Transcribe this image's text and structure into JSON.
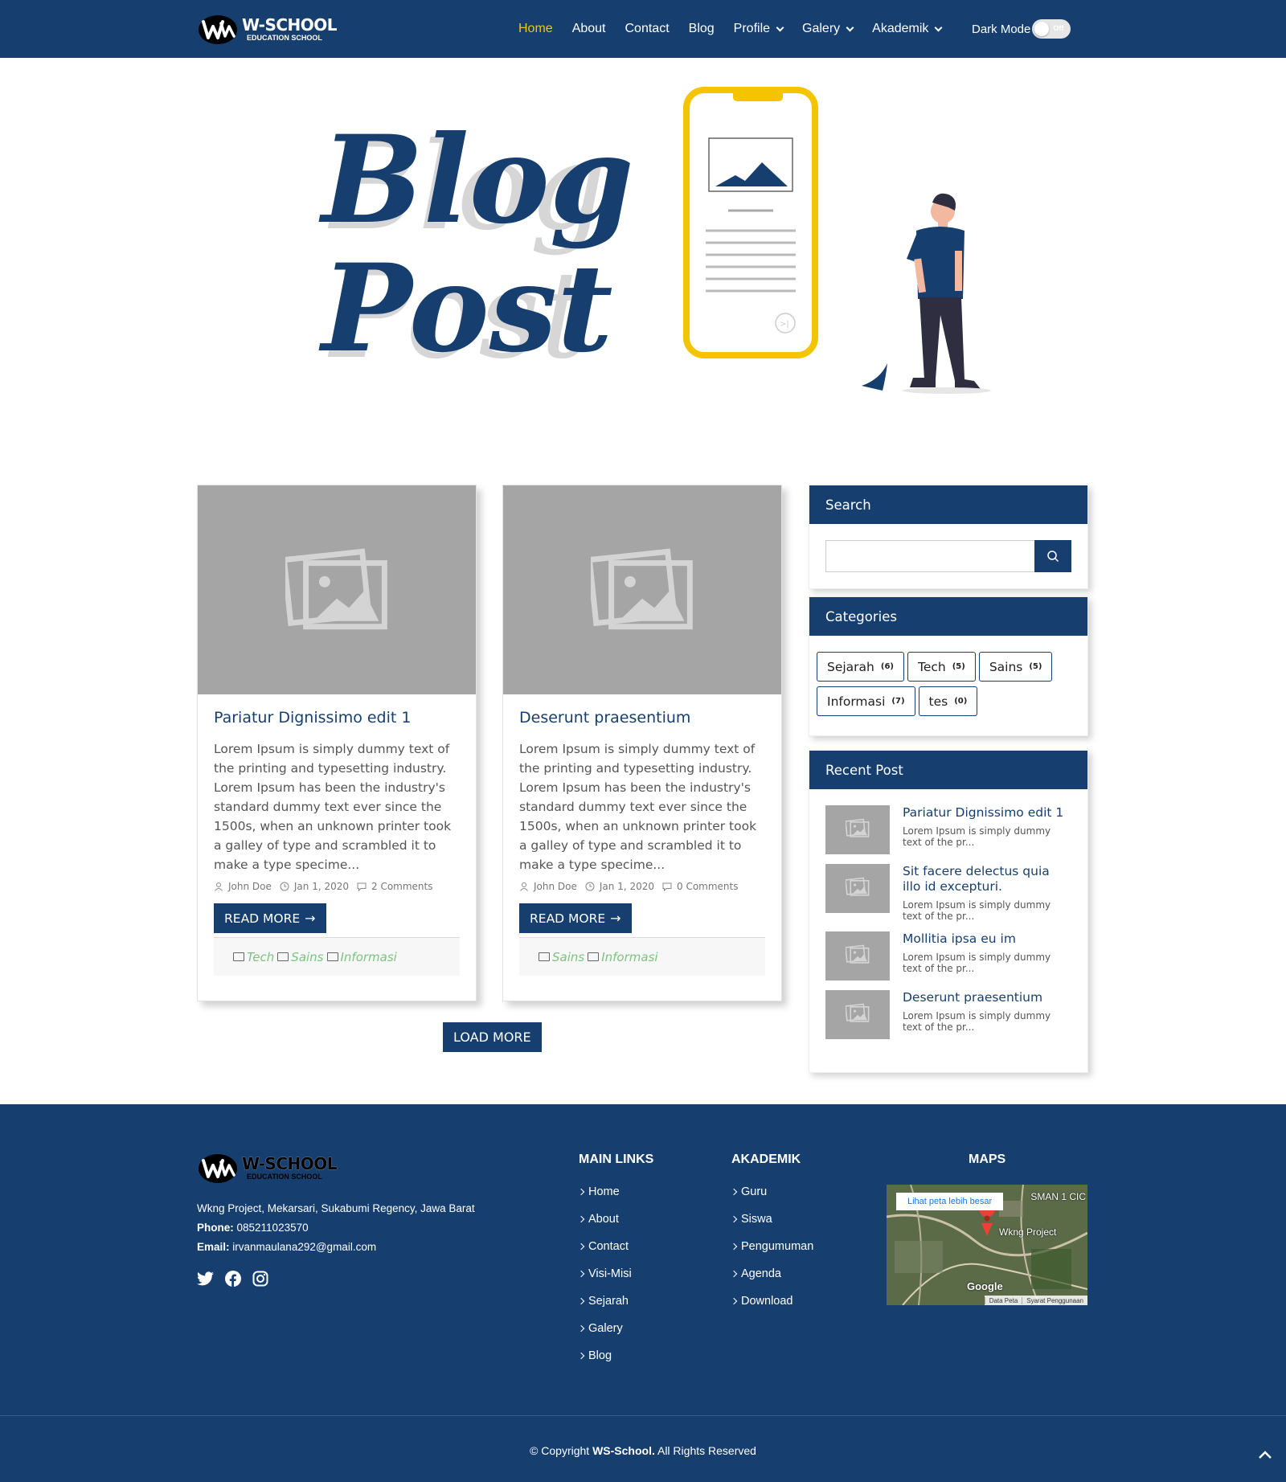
{
  "navbar": {
    "brand_name": "W-SCHOOL",
    "brand_sub": "EDUCATION SCHOOL",
    "items": [
      {
        "label": "Home",
        "active": true,
        "dropdown": false
      },
      {
        "label": "About",
        "active": false,
        "dropdown": false
      },
      {
        "label": "Contact",
        "active": false,
        "dropdown": false
      },
      {
        "label": "Blog",
        "active": false,
        "dropdown": false
      },
      {
        "label": "Profile",
        "active": false,
        "dropdown": true
      },
      {
        "label": "Galery",
        "active": false,
        "dropdown": true
      },
      {
        "label": "Akademik",
        "active": false,
        "dropdown": true
      }
    ],
    "dark_mode_label": "Dark Mode",
    "toggle_state": "Off"
  },
  "hero": {
    "title_line1": "Blog",
    "title_line2": "Post",
    "phone_badge": ">|"
  },
  "posts": [
    {
      "title": "Pariatur Dignissimo edit 1",
      "excerpt": "Lorem Ipsum is simply dummy text of the printing and typesetting industry. Lorem Ipsum has been the industry's standard dummy text ever since the 1500s, when an unknown printer took a galley of type and scrambled it to make a type specime...",
      "author": "John Doe",
      "date": "Jan 1, 2020",
      "comments": "2 Comments",
      "read_more": "READ MORE",
      "tags": [
        "Tech",
        "Sains",
        "Informasi"
      ]
    },
    {
      "title": "Deserunt praesentium",
      "excerpt": "Lorem Ipsum is simply dummy text of the printing and typesetting industry. Lorem Ipsum has been the industry's standard dummy text ever since the 1500s, when an unknown printer took a galley of type and scrambled it to make a type specime...",
      "author": "John Doe",
      "date": "Jan 1, 2020",
      "comments": "0 Comments",
      "read_more": "READ MORE",
      "tags": [
        "Sains",
        "Informasi"
      ]
    }
  ],
  "load_more": "LOAD MORE",
  "sidebar": {
    "search_title": "Search",
    "search_value": "",
    "categories_title": "Categories",
    "categories": [
      {
        "name": "Sejarah",
        "count": "(6)"
      },
      {
        "name": "Tech",
        "count": "(5)"
      },
      {
        "name": "Sains",
        "count": "(5)"
      },
      {
        "name": "Informasi",
        "count": "(7)"
      },
      {
        "name": "tes",
        "count": "(0)"
      }
    ],
    "recent_title": "Recent Post",
    "recent": [
      {
        "title": "Pariatur Dignissimo edit 1",
        "excerpt": "Lorem Ipsum is simply dummy text of the pr..."
      },
      {
        "title": "Sit facere delectus quia illo id excepturi.",
        "excerpt": "Lorem Ipsum is simply dummy text of the pr..."
      },
      {
        "title": "Mollitia ipsa eu im",
        "excerpt": "Lorem Ipsum is simply dummy text of the pr..."
      },
      {
        "title": "Deserunt praesentium",
        "excerpt": "Lorem Ipsum is simply dummy text of the pr..."
      }
    ]
  },
  "footer": {
    "brand_name": "W-SCHOOL",
    "brand_sub": "EDUCATION SCHOOL",
    "address": "Wkng Project, Mekarsari, Sukabumi Regency, Jawa Barat",
    "phone_label": "Phone:",
    "phone": "085211023570",
    "email_label": "Email:",
    "email": "irvanmaulana292@gmail.com",
    "main_links_title": "MAIN LINKS",
    "main_links": [
      "Home",
      "About",
      "Contact",
      "Visi-Misi",
      "Sejarah",
      "Galery",
      "Blog"
    ],
    "akademik_title": "AKADEMIK",
    "akademik_links": [
      "Guru",
      "Siswa",
      "Pengumuman",
      "Agenda",
      "Download"
    ],
    "maps_title": "MAPS",
    "map_link": "Lihat peta lebih besar",
    "map_place": "SMAN 1 CIC",
    "map_pin": "Wkng Project",
    "map_google": "Google",
    "map_data": "Data Peta",
    "map_terms": "Syarat Penggunaan",
    "copyright_prefix": "© Copyright",
    "copyright_brand": "WS-School.",
    "copyright_suffix": "All Rights Reserved"
  },
  "colors": {
    "primary": "#163f70",
    "accent": "#f0c419",
    "tag": "#7bc47f"
  }
}
